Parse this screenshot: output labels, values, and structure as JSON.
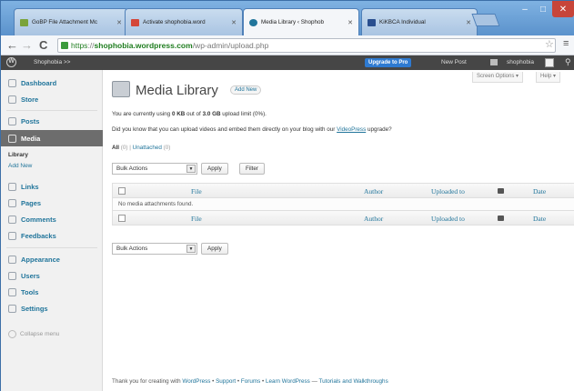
{
  "browser": {
    "tabs": [
      {
        "label": "GoBP File Attachment Mc",
        "color": "#7aa33a"
      },
      {
        "label": "Activate shophobia.word",
        "color": "#d44638"
      },
      {
        "label": "Media Library ‹ Shophob",
        "color": "#21759b"
      },
      {
        "label": "KiKBCA Individual",
        "color": "#2a4f8f"
      }
    ],
    "url": {
      "scheme": "https",
      "host": "shophobia.wordpress.com",
      "path": "/wp-admin/upload.php"
    }
  },
  "adminbar": {
    "site_name": "Shophobia >>",
    "upgrade_label": "Upgrade to Pro",
    "new_post_label": "New Post",
    "user_name": "shophobia"
  },
  "sidebar": {
    "dashboard": "Dashboard",
    "store": "Store",
    "posts": "Posts",
    "media": "Media",
    "media_sub": [
      "Library",
      "Add New"
    ],
    "links": "Links",
    "pages": "Pages",
    "comments": "Comments",
    "feedbacks": "Feedbacks",
    "appearance": "Appearance",
    "users": "Users",
    "tools": "Tools",
    "settings": "Settings",
    "collapse": "Collapse menu"
  },
  "main": {
    "screen_options": "Screen Options ▾",
    "help": "Help ▾",
    "title": "Media Library",
    "add_new": "Add New",
    "usage_prefix": "You are currently using ",
    "usage_used": "0 KB",
    "usage_mid": " out of ",
    "usage_total": "3.0 GB",
    "usage_suffix": " upload limit (0%).",
    "video_prefix": "Did you know that you can upload videos and embed them directly on your blog with our ",
    "video_link": "VideoPress",
    "video_suffix": " upgrade?",
    "filter_all": "All",
    "filter_all_count": "(0)",
    "filter_sep": "|",
    "filter_unattached": "Unattached",
    "filter_unattached_count": "(0)",
    "bulk_actions": "Bulk Actions",
    "apply": "Apply",
    "filter": "Filter",
    "columns": {
      "file": "File",
      "author": "Author",
      "uploaded_to": "Uploaded to",
      "date": "Date"
    },
    "empty_message": "No media attachments found."
  },
  "footer": {
    "thanks": "Thank you for creating with ",
    "wordpress": "WordPress",
    "sep": " • ",
    "support": "Support",
    "forums": "Forums",
    "learn": "Learn WordPress",
    "dash": " — ",
    "tutorials": "Tutorials and Walkthroughs"
  }
}
